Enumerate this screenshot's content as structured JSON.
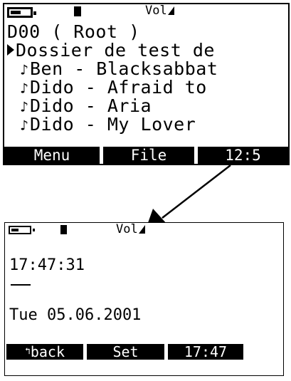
{
  "top_screen": {
    "status": {
      "volume_label": "Vol",
      "battery_level": 0.45
    },
    "path": "D00 ( Root )",
    "items": [
      {
        "icon": "folder-arrow-icon",
        "label": "Dossier de test de"
      },
      {
        "icon": "music-note-icon",
        "label": "Ben - Blacksabbat"
      },
      {
        "icon": "music-note-icon",
        "label": "Dido - Afraid to"
      },
      {
        "icon": "music-note-icon",
        "label": "Dido - Aria"
      },
      {
        "icon": "music-note-icon",
        "label": "Dido - My Lover"
      }
    ],
    "softkeys": {
      "left": "Menu",
      "middle": "File",
      "right": "12:5"
    }
  },
  "bottom_screen": {
    "status": {
      "volume_label": "Vol",
      "battery_level": 0.35
    },
    "time": "17:47:31",
    "date": "Tue 05.06.2001",
    "softkeys": {
      "left": "back",
      "left_icon": "return-arrow-icon",
      "middle": "Set",
      "right": "17:47"
    }
  },
  "colors": {
    "lcd_background": "#ffffff",
    "pixel": "#000000"
  }
}
